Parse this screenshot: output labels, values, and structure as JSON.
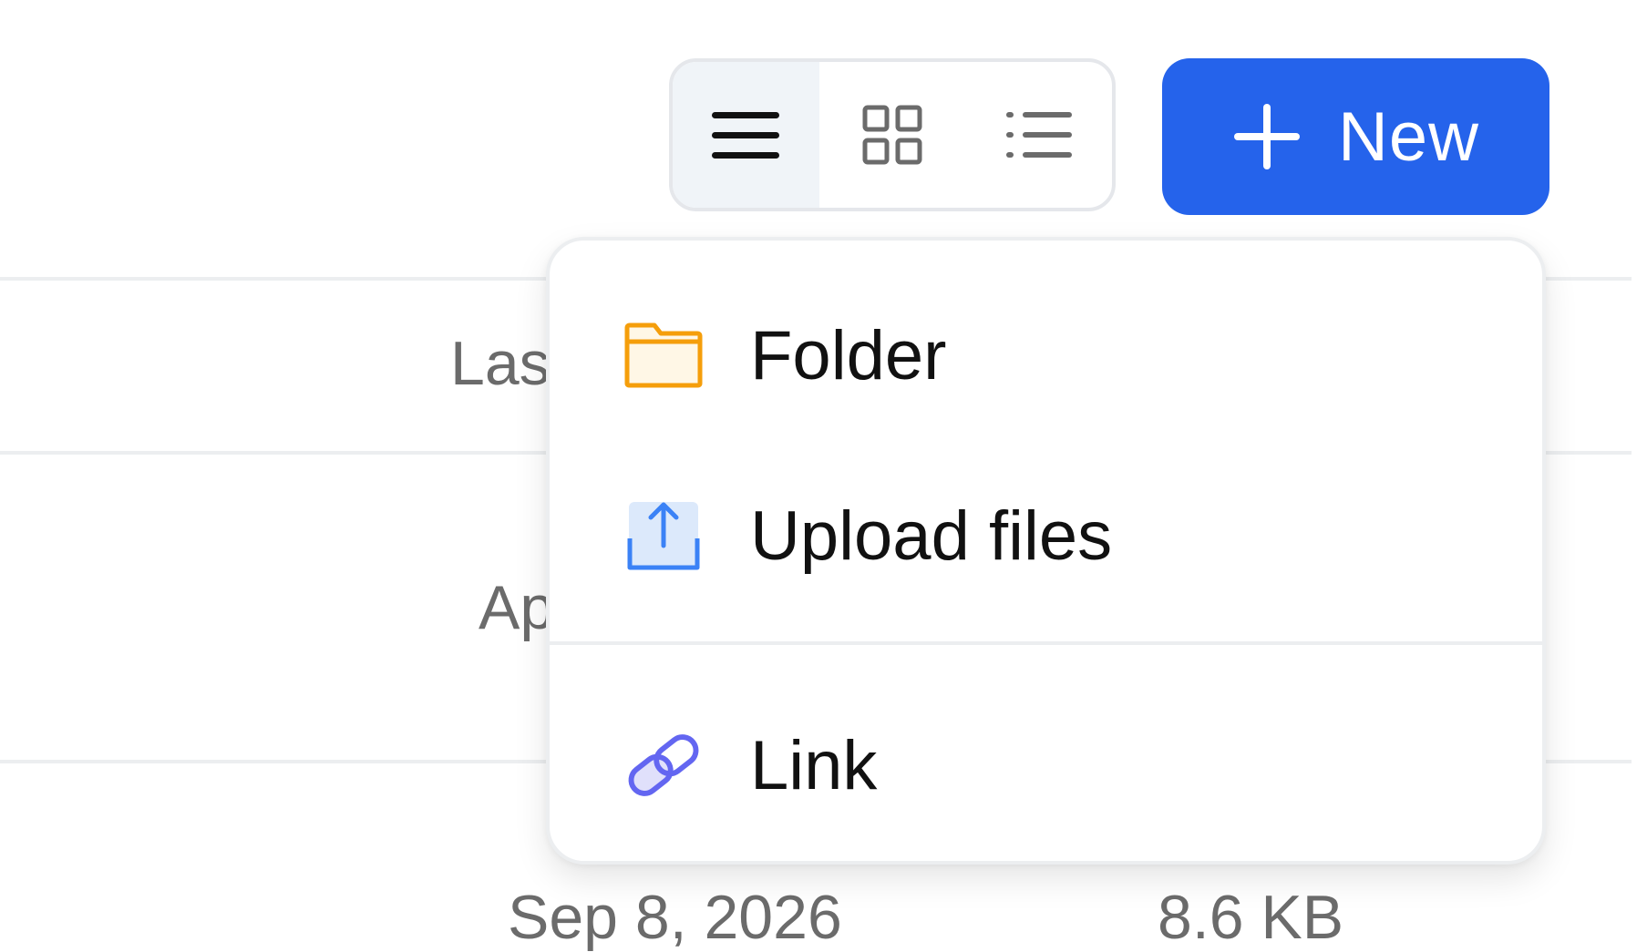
{
  "view_toggle": {
    "active": "compact-list",
    "options": [
      "compact-list-icon",
      "grid-icon",
      "detailed-list-icon"
    ]
  },
  "new_button": {
    "label": "New",
    "icon": "plus-icon",
    "color": "#2563eb"
  },
  "new_menu": {
    "items": [
      {
        "label": "Folder",
        "icon": "folder-icon",
        "icon_color": "#f59e0b"
      },
      {
        "label": "Upload files",
        "icon": "upload-icon",
        "icon_color": "#3b82f6"
      },
      {
        "label": "Link",
        "icon": "link-icon",
        "icon_color": "#6366f1"
      }
    ]
  },
  "table": {
    "header_partial": "Las",
    "row1_date_partial": "Ap",
    "row2": {
      "modified": "Sep 8, 2026",
      "size": "8.6 KB"
    }
  }
}
